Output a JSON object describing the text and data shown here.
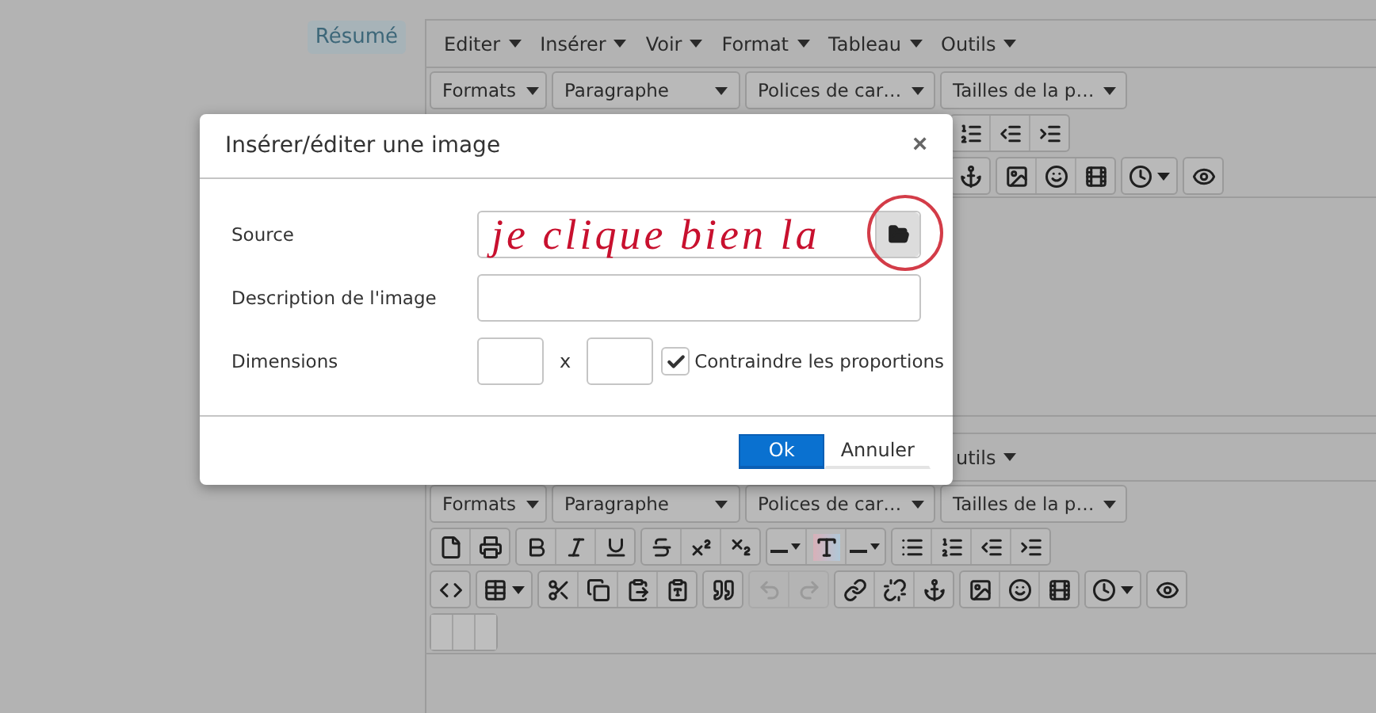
{
  "field_label": "Résumé",
  "editors": [
    {
      "menubar": [
        "Editer",
        "Insérer",
        "Voir",
        "Format",
        "Tableau",
        "Outils"
      ],
      "selects": [
        "Formats",
        "Paragraphe",
        "Polices de car…",
        "Tailles de la p…"
      ],
      "rows": [
        {
          "groups": [
            {
              "disabled": false,
              "buttons": [
                {
                  "kind": "numlist"
                },
                {
                  "kind": "outdent"
                },
                {
                  "kind": "indent"
                }
              ]
            }
          ]
        },
        {
          "groups": [
            {
              "disabled": false,
              "buttons": [
                {
                  "kind": "anchor"
                }
              ]
            },
            {
              "disabled": false,
              "buttons": [
                {
                  "kind": "image"
                },
                {
                  "kind": "emoji"
                },
                {
                  "kind": "media"
                }
              ]
            },
            {
              "disabled": false,
              "buttons": [
                {
                  "kind": "time"
                }
              ]
            },
            {
              "disabled": false,
              "buttons": [
                {
                  "kind": "preview"
                }
              ]
            }
          ]
        }
      ]
    },
    {
      "menubar": [
        "utils"
      ],
      "selects": [
        "Formats",
        "Paragraphe",
        "Polices de car…",
        "Tailles de la p…"
      ],
      "rows": [
        {
          "groups": [
            {
              "disabled": false,
              "buttons": [
                {
                  "kind": "newdoc"
                },
                {
                  "kind": "print"
                }
              ]
            },
            {
              "disabled": false,
              "buttons": [
                {
                  "kind": "bold"
                },
                {
                  "kind": "italic"
                },
                {
                  "kind": "underline"
                }
              ]
            },
            {
              "disabled": false,
              "buttons": [
                {
                  "kind": "strike"
                },
                {
                  "kind": "sup"
                },
                {
                  "kind": "sub"
                }
              ]
            },
            {
              "disabled": false,
              "buttons": [
                {
                  "kind": "color"
                },
                {
                  "kind": "forecolor"
                },
                {
                  "kind": "color"
                }
              ]
            },
            {
              "disabled": false,
              "buttons": [
                {
                  "kind": "bullist"
                },
                {
                  "kind": "numlist"
                },
                {
                  "kind": "outdent"
                },
                {
                  "kind": "indent"
                }
              ]
            }
          ]
        },
        {
          "groups": [
            {
              "disabled": false,
              "buttons": [
                {
                  "kind": "code"
                }
              ]
            },
            {
              "disabled": false,
              "buttons": [
                {
                  "kind": "table"
                }
              ]
            },
            {
              "disabled": false,
              "buttons": [
                {
                  "kind": "cut"
                },
                {
                  "kind": "copy"
                },
                {
                  "kind": "paste"
                },
                {
                  "kind": "pastetext"
                }
              ]
            },
            {
              "disabled": false,
              "buttons": [
                {
                  "kind": "quote"
                }
              ]
            },
            {
              "disabled": true,
              "buttons": [
                {
                  "kind": "undo"
                },
                {
                  "kind": "redo"
                }
              ]
            },
            {
              "disabled": false,
              "buttons": [
                {
                  "kind": "link"
                },
                {
                  "kind": "unlink"
                },
                {
                  "kind": "anchor"
                }
              ]
            },
            {
              "disabled": false,
              "buttons": [
                {
                  "kind": "image"
                },
                {
                  "kind": "emoji"
                },
                {
                  "kind": "media"
                }
              ]
            },
            {
              "disabled": false,
              "buttons": [
                {
                  "kind": "time"
                }
              ]
            },
            {
              "disabled": false,
              "buttons": [
                {
                  "kind": "preview"
                }
              ]
            }
          ]
        },
        {
          "groups": [
            {
              "disabled": false,
              "buttons": [
                {
                  "kind": "blank"
                },
                {
                  "kind": "blank"
                },
                {
                  "kind": "blank"
                }
              ]
            }
          ]
        }
      ]
    }
  ],
  "dialog": {
    "title": "Insérer/éditer une image",
    "close": "×",
    "fields": [
      {
        "kind": "browse",
        "label": "Source"
      },
      {
        "kind": "text",
        "label": "Description de l'image"
      },
      {
        "kind": "dimensions",
        "label": "Dimensions",
        "separator": "x",
        "checkbox": {
          "label": "Contraindre les proportions",
          "checked": true
        }
      }
    ],
    "annotation": "je clique bien la",
    "buttons": [
      {
        "label": "Ok",
        "primary": true
      },
      {
        "label": "Annuler",
        "primary": false
      }
    ]
  }
}
